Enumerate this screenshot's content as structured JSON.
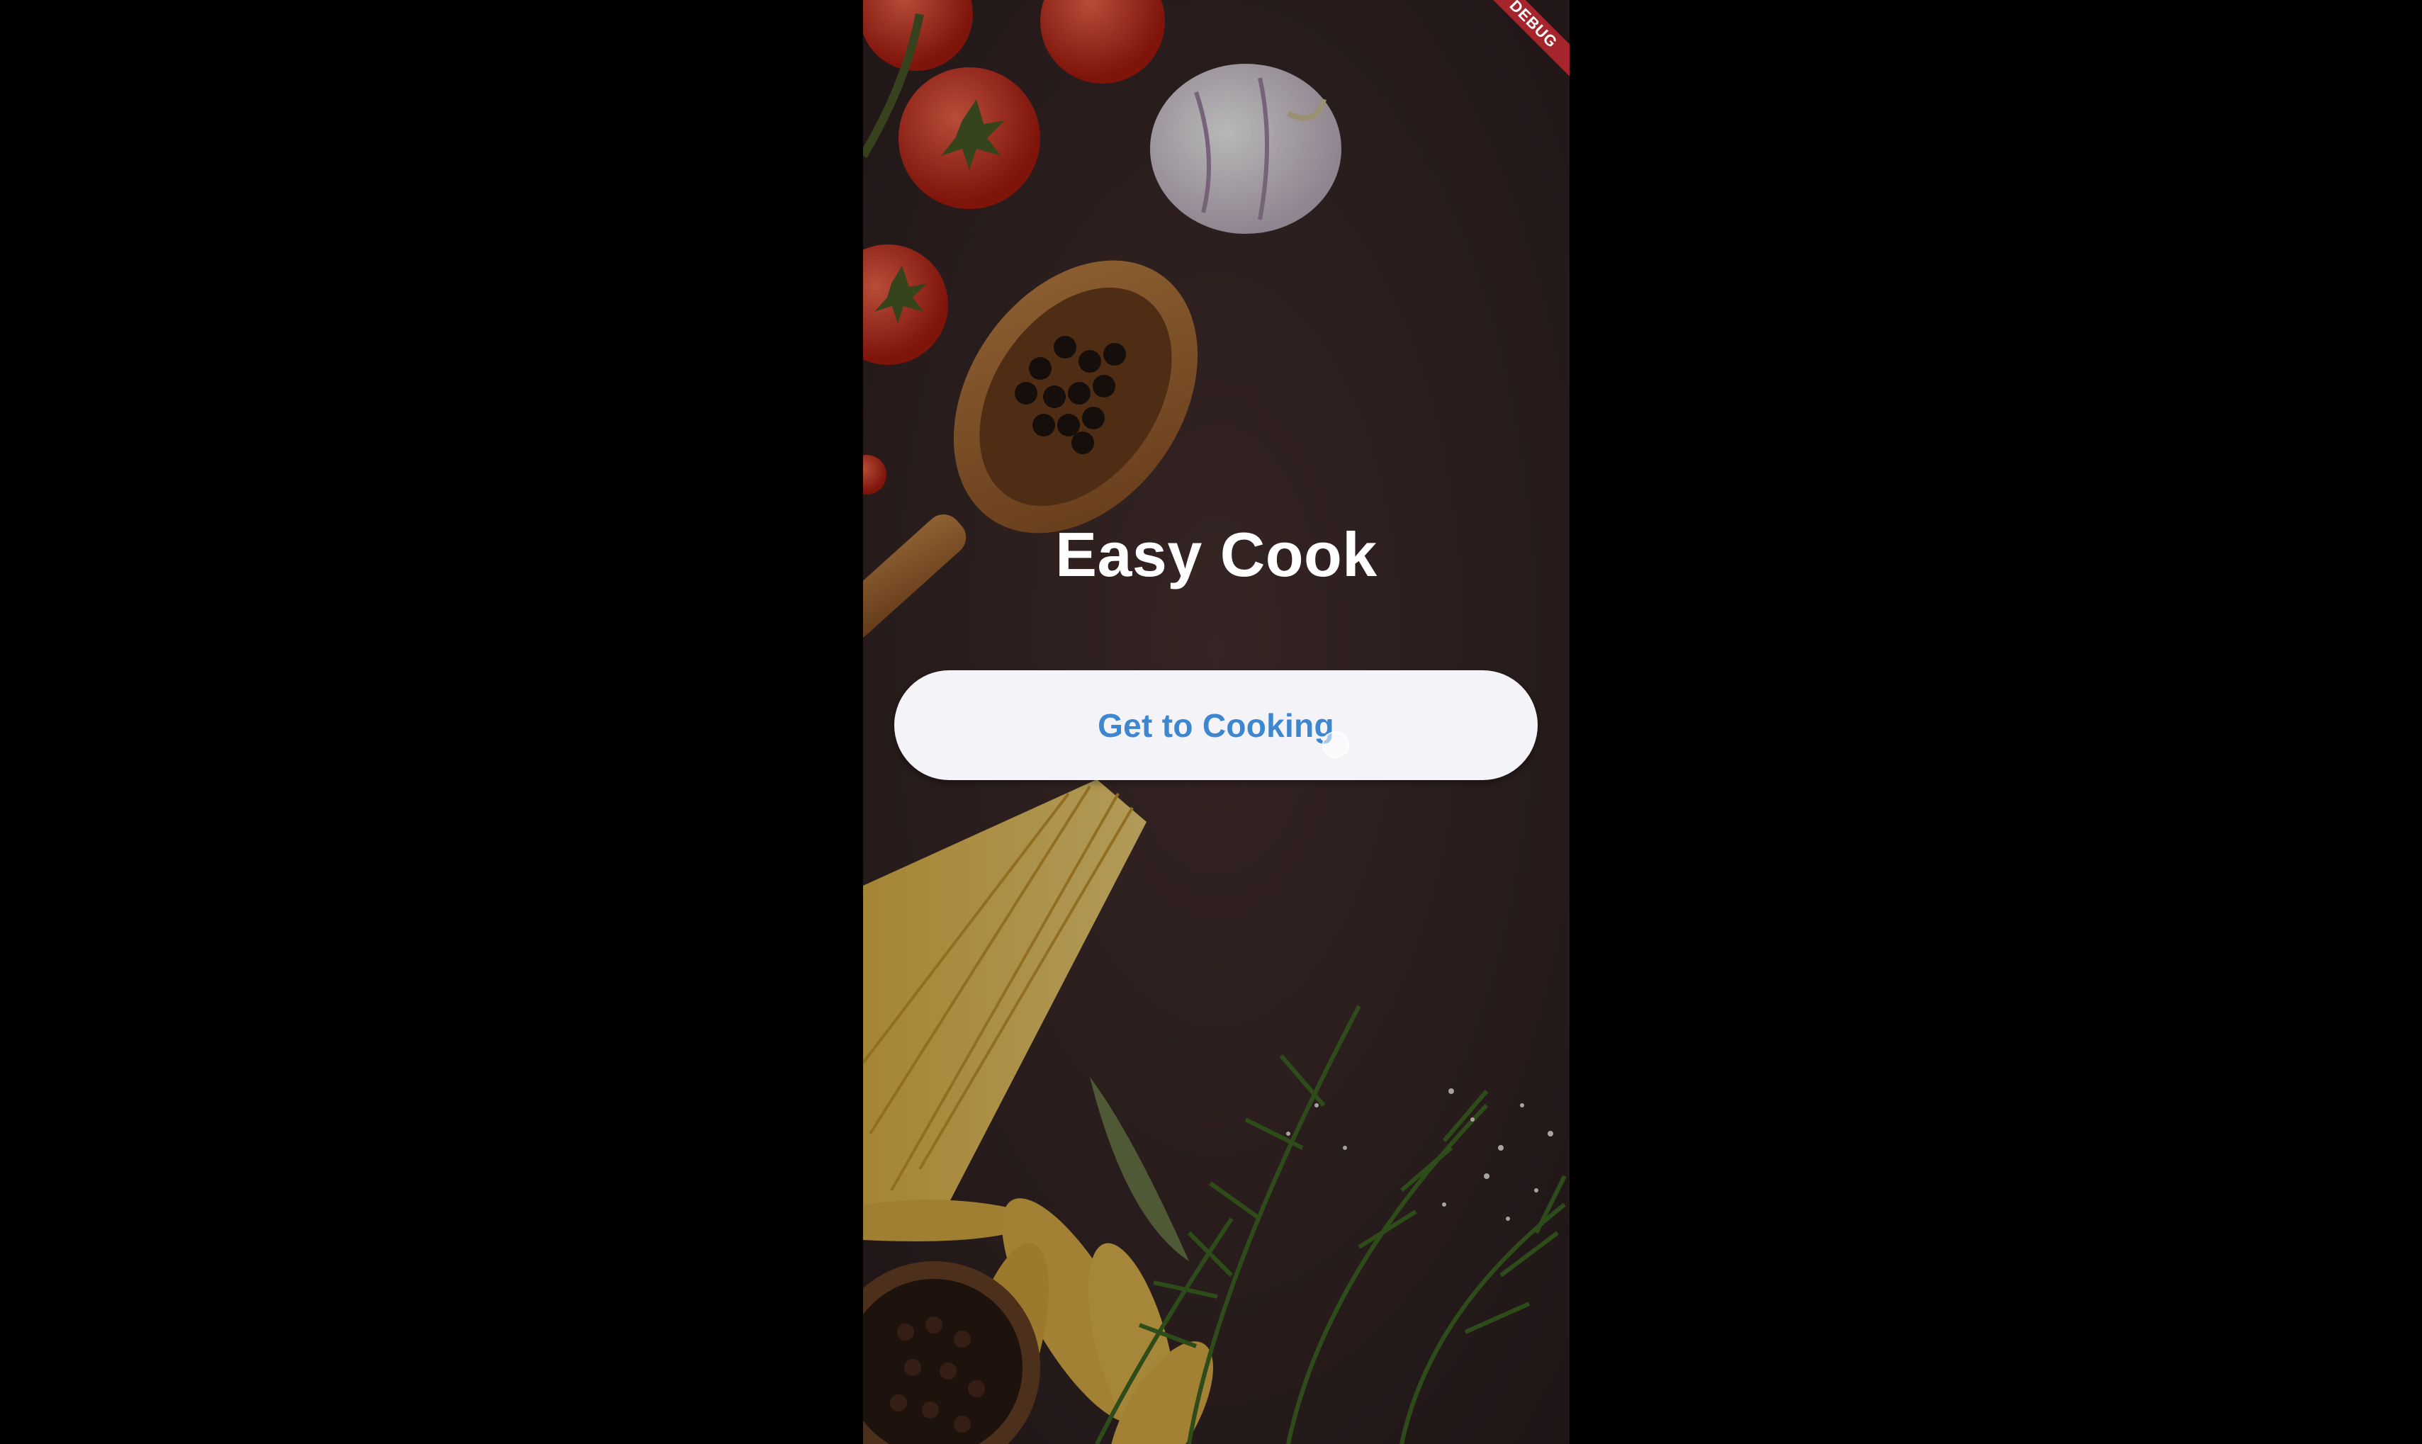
{
  "app": {
    "title": "Easy Cook",
    "cta_label": "Get to Cooking",
    "debug_banner": "DEBUG"
  },
  "colors": {
    "page_background": "#000000",
    "title_text": "#ffffff",
    "button_background": "#f4f3f8",
    "button_text": "#3d86d0",
    "debug_banner": "#a4262c"
  },
  "background": {
    "description_icons": [
      "tomato-icon",
      "garlic-icon",
      "wooden-spoon-peppercorns-icon",
      "spaghetti-icon",
      "fusilli-icon",
      "dill-herb-icon",
      "bay-leaf-icon",
      "peppercorn-bowl-icon",
      "salt-sprinkle-icon"
    ]
  }
}
